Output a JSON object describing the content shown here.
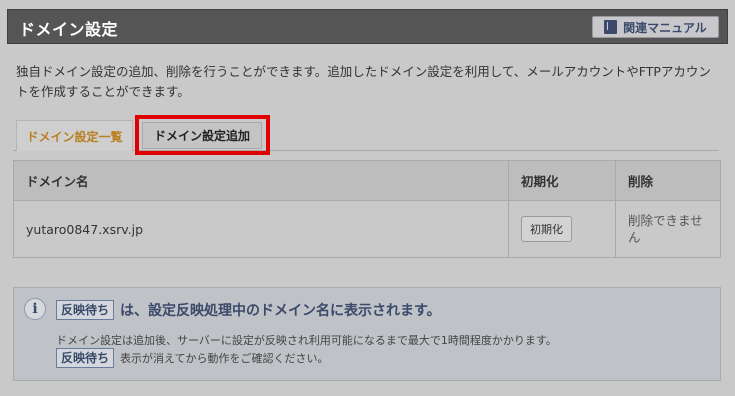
{
  "header": {
    "title": "ドメイン設定",
    "manual_button": "関連マニュアル"
  },
  "description": "独自ドメイン設定の追加、削除を行うことができます。追加したドメイン設定を利用して、メールアカウントやFTPアカウントを作成することができます。",
  "tabs": [
    {
      "label": "ドメイン設定一覧",
      "active": true
    },
    {
      "label": "ドメイン設定追加",
      "active": false
    }
  ],
  "table": {
    "headers": [
      "ドメイン名",
      "初期化",
      "削除"
    ],
    "rows": [
      {
        "domain": "yutaro0847.xsrv.jp",
        "init_button": "初期化",
        "delete_text": "削除できません"
      }
    ]
  },
  "info": {
    "icon": "info-icon",
    "badge": "反映待ち",
    "headline": "は、設定反映処理中のドメイン名に表示されます。",
    "line1": "ドメイン設定は追加後、サーバーに設定が反映され利用可能になるまで最大で1時間程度かかります。",
    "line2": "表示が消えてから動作をご確認ください。"
  },
  "colors": {
    "header_bg": "#555555",
    "active_tab_text": "#b9801f",
    "highlight": "#e00000",
    "info_text": "#3b4a6a"
  }
}
